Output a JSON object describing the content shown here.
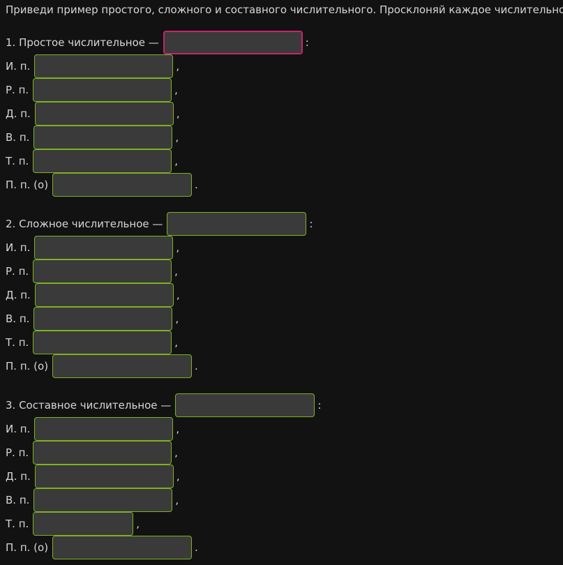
{
  "task": "Приведи пример простого, сложного и составного числительного. Просклоняй каждое числительное.",
  "sections": [
    {
      "title": "1. Простое числительное —",
      "title_punct": ":",
      "cases": [
        {
          "label": "И. п.",
          "punct": ","
        },
        {
          "label": "Р. п.",
          "punct": ","
        },
        {
          "label": "Д. п.",
          "punct": ","
        },
        {
          "label": "В. п.",
          "punct": ","
        },
        {
          "label": "Т. п.",
          "punct": ","
        },
        {
          "label": "П. п. (о)",
          "punct": "."
        }
      ]
    },
    {
      "title": "2. Сложное числительное —",
      "title_punct": ":",
      "cases": [
        {
          "label": "И. п.",
          "punct": ","
        },
        {
          "label": "Р. п.",
          "punct": ","
        },
        {
          "label": "Д. п.",
          "punct": ","
        },
        {
          "label": "В. п.",
          "punct": ","
        },
        {
          "label": "Т. п.",
          "punct": ","
        },
        {
          "label": "П. п. (о)",
          "punct": "."
        }
      ]
    },
    {
      "title": "3. Составное числительное —",
      "title_punct": ":",
      "cases": [
        {
          "label": "И. п.",
          "punct": ","
        },
        {
          "label": "Р. п.",
          "punct": ","
        },
        {
          "label": "Д. п.",
          "punct": ","
        },
        {
          "label": "В. п.",
          "punct": ","
        },
        {
          "label": "Т. п.",
          "punct": ","
        },
        {
          "label": "П. п. (о)",
          "punct": "."
        }
      ]
    }
  ],
  "colors": {
    "background": "#121212",
    "field_fill": "#3a3a3a",
    "field_border": "#7fb21f",
    "focus_border": "#c7256a",
    "text": "#d6d6d6"
  }
}
